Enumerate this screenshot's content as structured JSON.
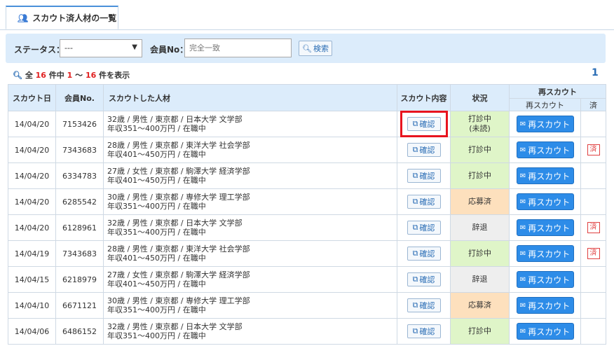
{
  "tab": {
    "icon": "users-icon",
    "label": "スカウト済人材の一覧"
  },
  "search": {
    "status_label": "ステータス：",
    "status_value": "---",
    "member_label": "会員No：",
    "member_placeholder": "完全一致",
    "button_label": "検索"
  },
  "summary": {
    "prefix": "全",
    "total": "16",
    "mid1": "件中",
    "start": "1",
    "tilde": "〜",
    "end": "16",
    "suffix": "件を表示",
    "page": "1"
  },
  "table": {
    "headers": {
      "date": "スカウト日",
      "member": "会員No.",
      "talent": "スカウトした人材",
      "content": "スカウト内容",
      "status": "状況",
      "rescout_group": "再スカウト",
      "rescout": "再スカウト",
      "done": "済"
    },
    "confirm_label": "確認",
    "rescout_label": "再スカウト",
    "done_label": "済",
    "rows": [
      {
        "date": "14/04/20",
        "member": "7153426",
        "line1": "32歳 / 男性 / 東京都 / 日本大学 文学部",
        "line2": "年収351〜400万円 / 在職中",
        "status1": "打診中",
        "status2": "(未読)",
        "tone": "green",
        "done": false
      },
      {
        "date": "14/04/20",
        "member": "7343683",
        "line1": "28歳 / 男性 / 東京都 / 東洋大学 社会学部",
        "line2": "年収401〜450万円 / 在職中",
        "status1": "打診中",
        "status2": "",
        "tone": "green",
        "done": true
      },
      {
        "date": "14/04/20",
        "member": "6334783",
        "line1": "27歳 / 女性 / 東京都 / 駒澤大学 経済学部",
        "line2": "年収401〜450万円 / 在職中",
        "status1": "打診中",
        "status2": "",
        "tone": "green",
        "done": false
      },
      {
        "date": "14/04/20",
        "member": "6285542",
        "line1": "30歳 / 男性 / 東京都 / 専修大学 理工学部",
        "line2": "年収351〜400万円 / 在職中",
        "status1": "応募済",
        "status2": "",
        "tone": "orange",
        "done": false
      },
      {
        "date": "14/04/20",
        "member": "6128961",
        "line1": "32歳 / 男性 / 東京都 / 日本大学 文学部",
        "line2": "年収351〜400万円 / 在職中",
        "status1": "辞退",
        "status2": "",
        "tone": "gray",
        "done": true
      },
      {
        "date": "14/04/19",
        "member": "7343683",
        "line1": "28歳 / 男性 / 東京都 / 東洋大学 社会学部",
        "line2": "年収401〜450万円 / 在職中",
        "status1": "打診中",
        "status2": "",
        "tone": "green",
        "done": true
      },
      {
        "date": "14/04/15",
        "member": "6218979",
        "line1": "27歳 / 女性 / 東京都 / 駒澤大学 経済学部",
        "line2": "年収401〜450万円 / 在職中",
        "status1": "辞退",
        "status2": "",
        "tone": "gray",
        "done": false
      },
      {
        "date": "14/04/10",
        "member": "6671121",
        "line1": "30歳 / 男性 / 東京都 / 専修大学 理工学部",
        "line2": "年収351〜400万円 / 在職中",
        "status1": "応募済",
        "status2": "",
        "tone": "orange",
        "done": false
      },
      {
        "date": "14/04/06",
        "member": "6486152",
        "line1": "32歳 / 男性 / 東京都 / 日本大学 文学部",
        "line2": "年収351〜400万円 / 在職中",
        "status1": "打診中",
        "status2": "",
        "tone": "green",
        "done": false
      }
    ]
  }
}
